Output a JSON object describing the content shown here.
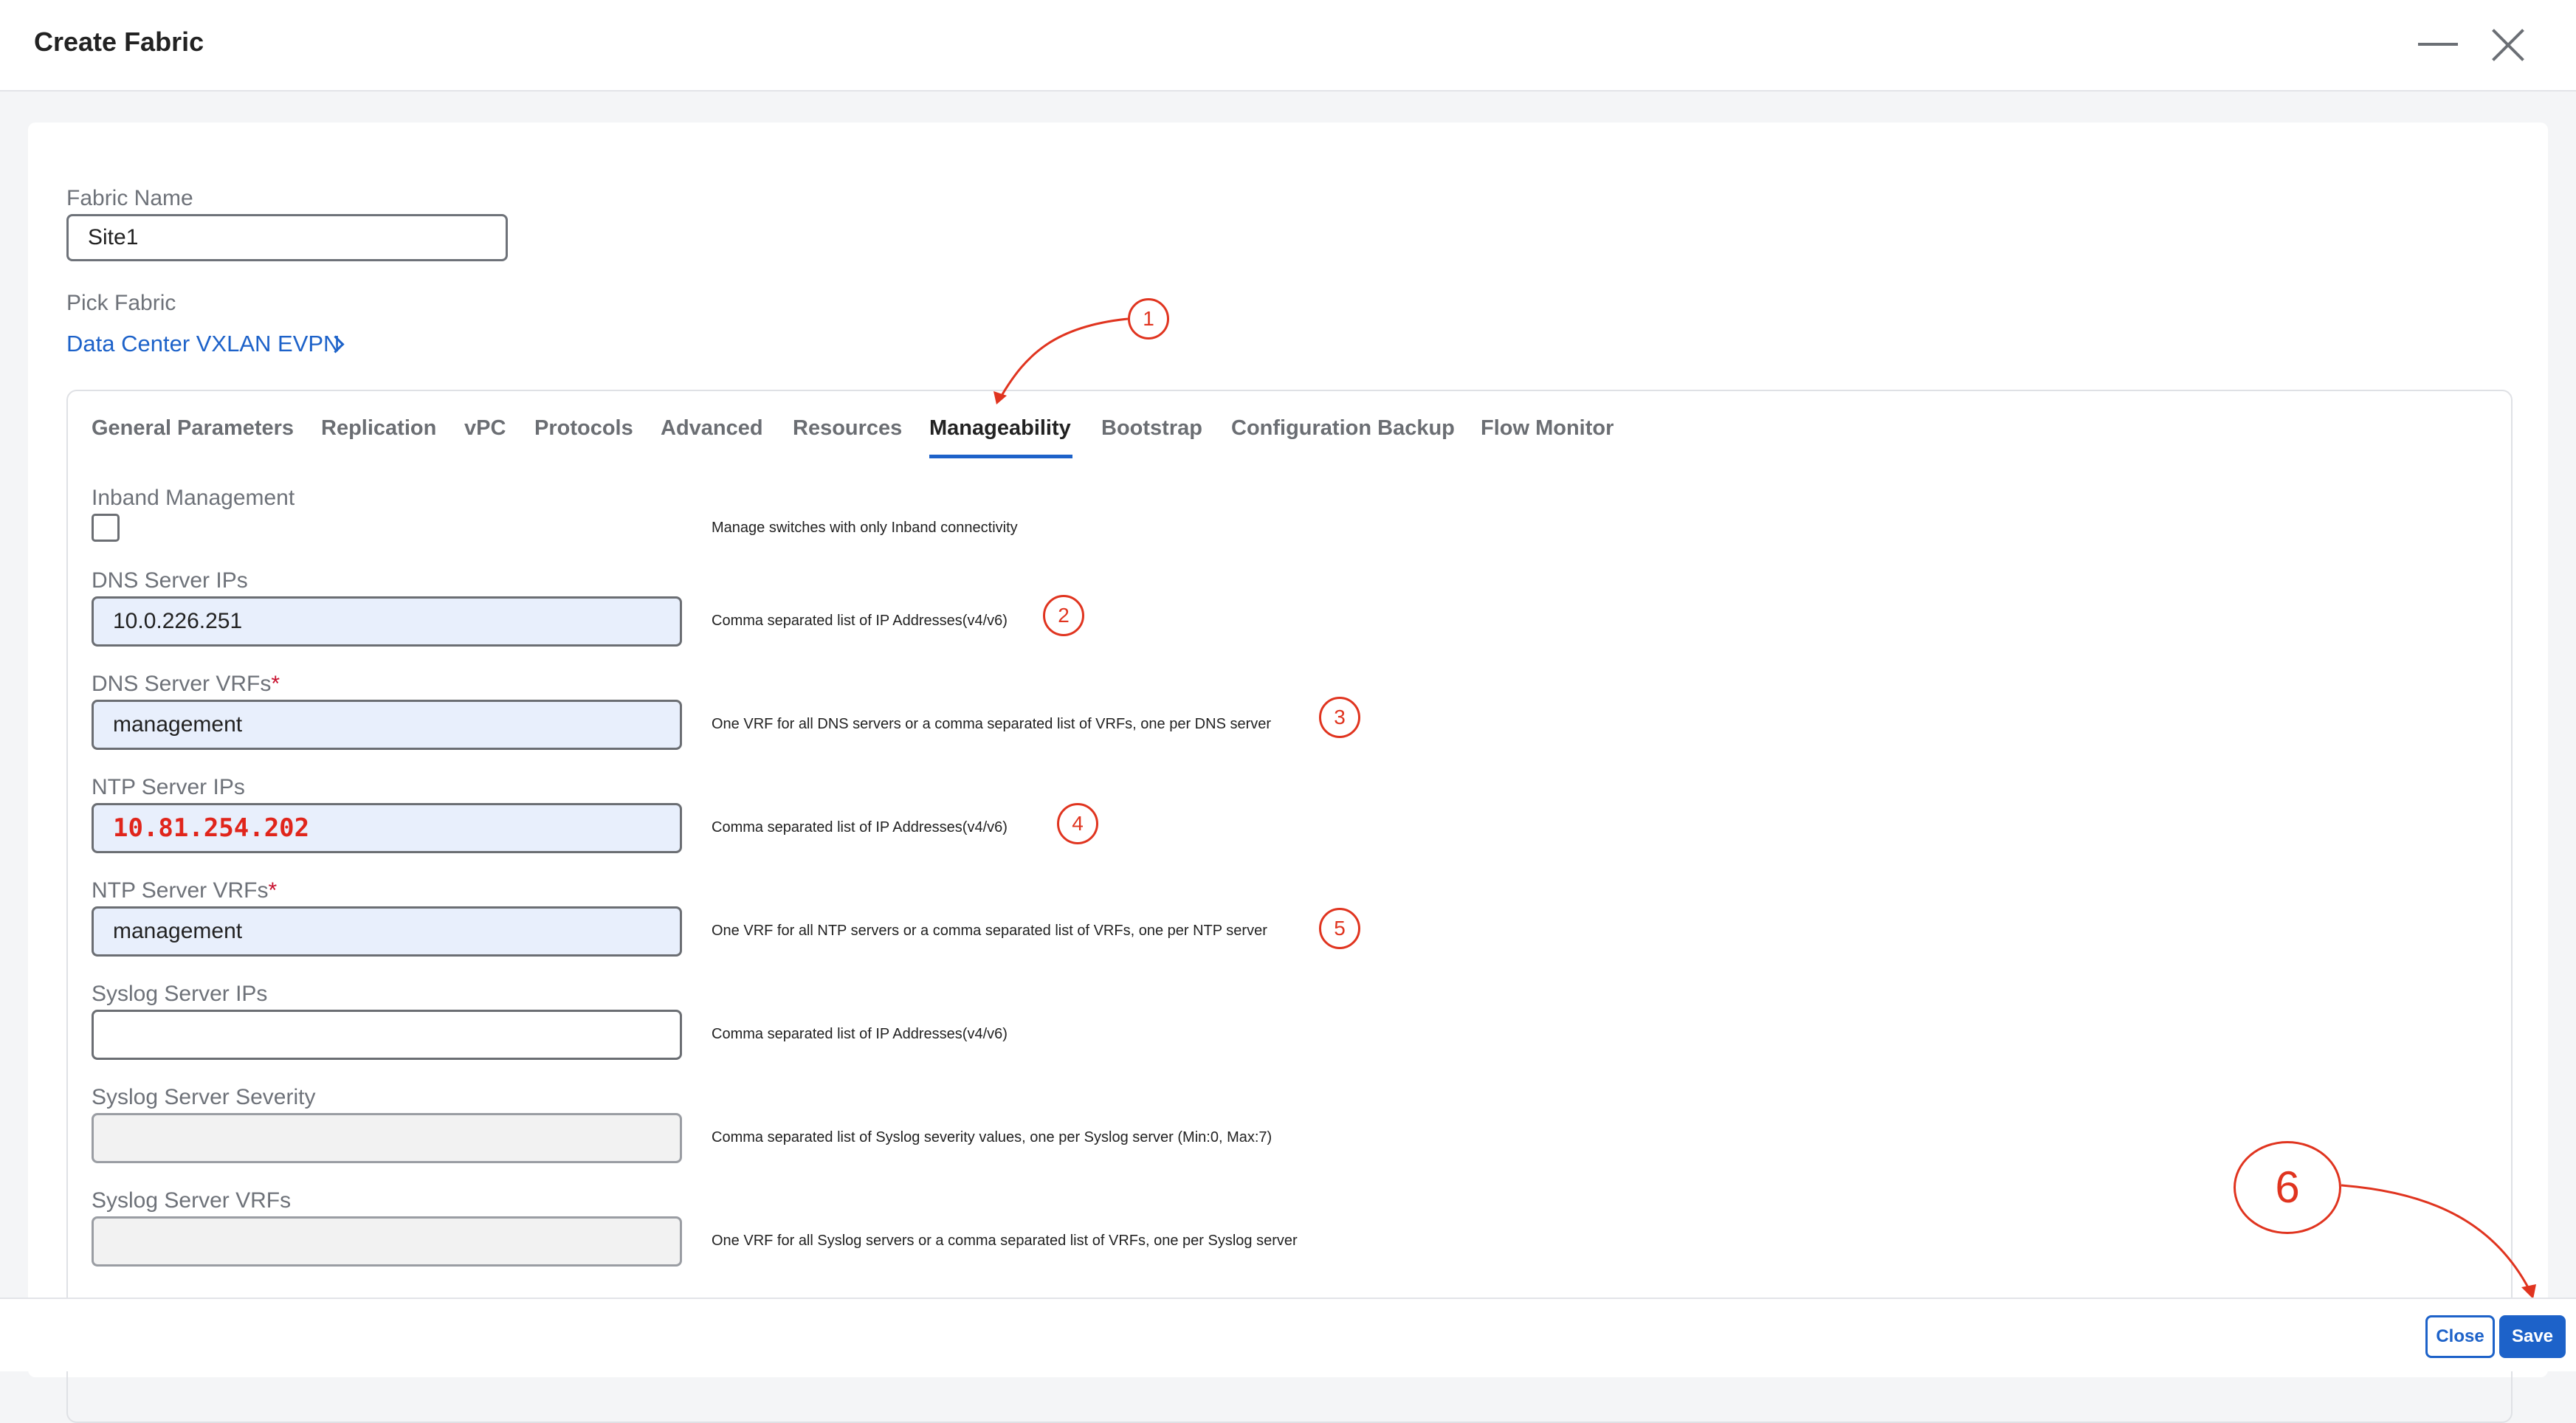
{
  "window": {
    "title": "Create Fabric"
  },
  "fabric_name": {
    "label": "Fabric Name",
    "value": "Site1"
  },
  "pick_fabric": {
    "label": "Pick Fabric",
    "link": "Data Center VXLAN EVPN"
  },
  "tabs": [
    {
      "label": "General Parameters"
    },
    {
      "label": "Replication"
    },
    {
      "label": "vPC"
    },
    {
      "label": "Protocols"
    },
    {
      "label": "Advanced"
    },
    {
      "label": "Resources"
    },
    {
      "label": "Manageability",
      "active": true
    },
    {
      "label": "Bootstrap"
    },
    {
      "label": "Configuration Backup"
    },
    {
      "label": "Flow Monitor"
    }
  ],
  "inband": {
    "label": "Inband Management",
    "checked": false,
    "desc": "Manage switches with only Inband connectivity"
  },
  "fields": {
    "dns_ips": {
      "label": "DNS Server IPs",
      "value": "10.0.226.251",
      "desc": "Comma separated list of IP Addresses(v4/v6)"
    },
    "dns_vrfs": {
      "label": "DNS Server VRFs",
      "required": "*",
      "value": "management",
      "desc": "One VRF for all DNS servers or a comma separated list of VRFs, one per DNS server"
    },
    "ntp_ips": {
      "label": "NTP Server IPs",
      "value": "10.81.254.202",
      "desc": "Comma separated list of IP Addresses(v4/v6)"
    },
    "ntp_vrfs": {
      "label": "NTP Server VRFs",
      "required": "*",
      "value": "management",
      "desc": "One VRF for all NTP servers or a comma separated list of VRFs, one per NTP server"
    },
    "syslog_ips": {
      "label": "Syslog Server IPs",
      "value": "",
      "desc": "Comma separated list of IP Addresses(v4/v6)"
    },
    "syslog_severity": {
      "label": "Syslog Server Severity",
      "value": "",
      "desc": "Comma separated list of Syslog severity values, one per Syslog server (Min:0, Max:7)"
    },
    "syslog_vrfs": {
      "label": "Syslog Server VRFs",
      "value": "",
      "desc": "One VRF for all Syslog servers or a comma separated list of VRFs, one per Syslog server"
    }
  },
  "annotations": [
    "1",
    "2",
    "3",
    "4",
    "5",
    "6"
  ],
  "footer": {
    "close_label": "Close",
    "save_label": "Save"
  },
  "colors": {
    "accent": "#1d62c9",
    "annotation": "#e0341f",
    "required": "#c8102e"
  }
}
